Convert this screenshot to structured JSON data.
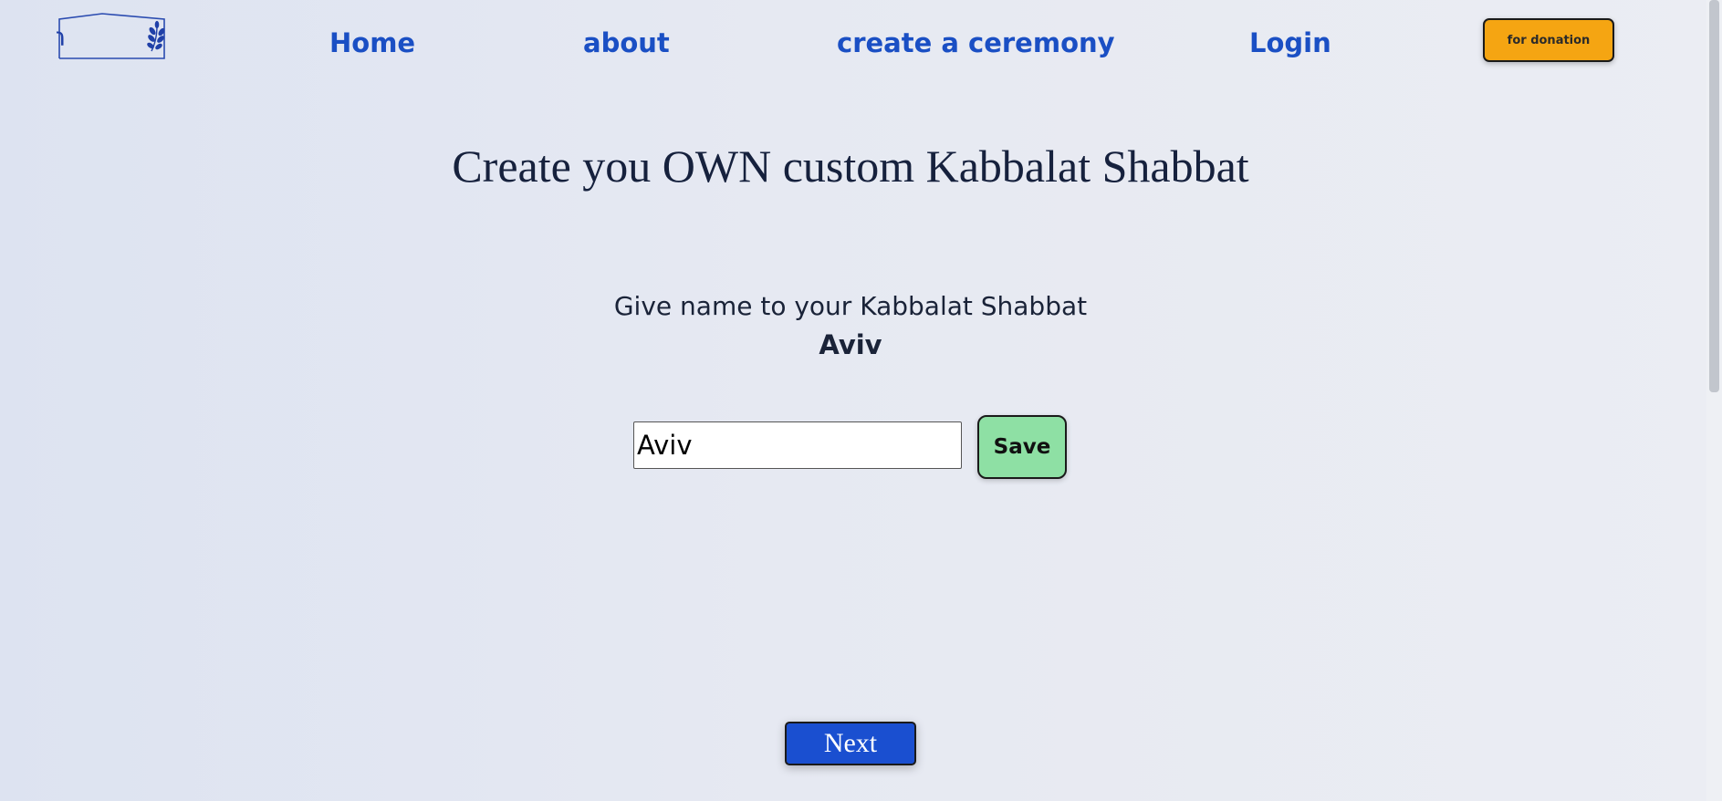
{
  "header": {
    "logo_text": "הבית",
    "nav": {
      "home": "Home",
      "about": "about",
      "create": "create a ceremony",
      "login": "Login"
    },
    "donate_label": "for donation"
  },
  "main": {
    "title": "Create you OWN custom Kabbalat Shabbat",
    "prompt_label": "Give name to your Kabbalat Shabbat",
    "current_name": "Aviv",
    "name_input_value": "Aviv",
    "save_label": "Save",
    "next_label": "Next"
  },
  "colors": {
    "nav_link": "#1a4fc4",
    "donate_button": "#f5a512",
    "save_button": "#8ee0a4",
    "next_button": "#1a4fd0"
  },
  "icons": {
    "logo": "house-with-olive-branch-logo-icon"
  }
}
